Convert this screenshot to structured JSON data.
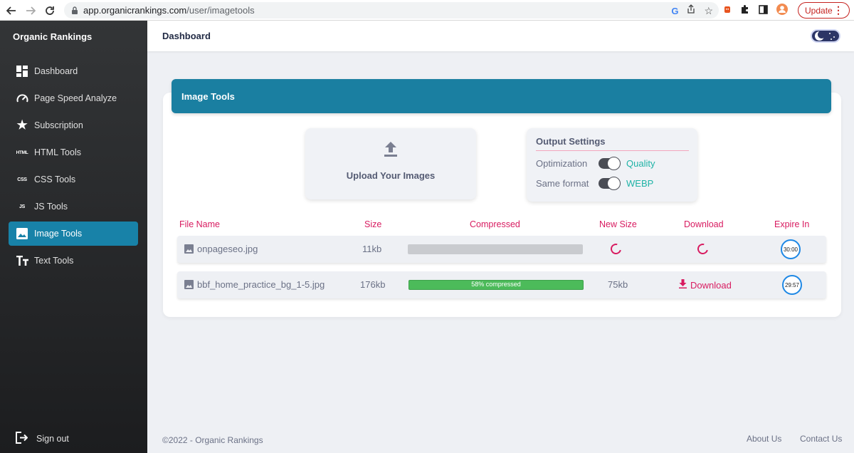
{
  "browser": {
    "url_domain": "app.organicrankings.com",
    "url_path": "/user/imagetools",
    "update_label": "Update"
  },
  "sidebar": {
    "brand": "Organic Rankings",
    "items": [
      {
        "label": "Dashboard",
        "icon": "dashboard-icon"
      },
      {
        "label": "Page Speed Analyze",
        "icon": "speedometer-icon"
      },
      {
        "label": "Subscription",
        "icon": "star-icon"
      },
      {
        "label": "HTML Tools",
        "icon": "html-icon",
        "icon_text": "HTML"
      },
      {
        "label": "CSS Tools",
        "icon": "css-icon",
        "icon_text": "CSS"
      },
      {
        "label": "JS Tools",
        "icon": "js-icon",
        "icon_text": "JS"
      },
      {
        "label": "Image Tools",
        "icon": "image-icon",
        "active": true
      },
      {
        "label": "Text Tools",
        "icon": "text-icon"
      }
    ],
    "signout_label": "Sign out"
  },
  "header": {
    "title": "Dashboard"
  },
  "card": {
    "title": "Image Tools",
    "upload_label": "Upload Your Images",
    "settings": {
      "title": "Output Settings",
      "rows": [
        {
          "label": "Optimization",
          "value": "Quality",
          "on": true
        },
        {
          "label": "Same format",
          "value": "WEBP",
          "on": true
        }
      ]
    }
  },
  "table": {
    "headers": [
      "File Name",
      "Size",
      "Compressed",
      "New Size",
      "Download",
      "Expire In"
    ],
    "rows": [
      {
        "file_name": "onpageseo.jpg",
        "size": "11kb",
        "progress": 0,
        "progress_text": "",
        "new_size": "",
        "download": "",
        "expire": "30:00",
        "status": "processing"
      },
      {
        "file_name": "bbf_home_practice_bg_1-5.jpg",
        "size": "176kb",
        "progress": 100,
        "progress_text": "58% compressed",
        "new_size": "75kb",
        "download": "Download",
        "expire": "29:57",
        "status": "done"
      }
    ]
  },
  "footer": {
    "copyright": "©2022 - Organic Rankings",
    "about": "About Us",
    "contact": "Contact Us"
  },
  "colors": {
    "accent": "#1a7fa1",
    "header_text": "#d81b60",
    "toggle_value": "#1fb3a6",
    "progress_fill": "#4cbb5a"
  }
}
